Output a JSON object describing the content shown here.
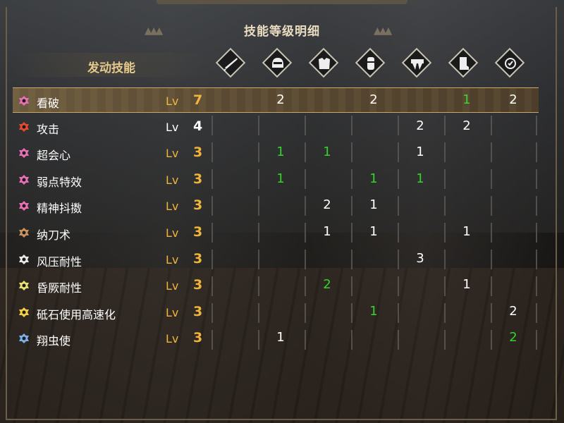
{
  "title": "技能等级明细",
  "header_label": "发动技能",
  "lv_label": "Lv",
  "slots": [
    {
      "icon": "weapon-icon"
    },
    {
      "icon": "helmet-icon"
    },
    {
      "icon": "chest-armor-icon"
    },
    {
      "icon": "arm-armor-icon"
    },
    {
      "icon": "waist-armor-icon"
    },
    {
      "icon": "leg-armor-icon"
    },
    {
      "icon": "talisman-icon"
    }
  ],
  "colors": {
    "level_gold": "#f0b43a",
    "decoration_green": "#33d32b",
    "highlight": "#6b5a3e"
  },
  "rows": [
    {
      "name": "看破",
      "icon_color": "#e86fb3",
      "level": "7",
      "lv_style": "gold",
      "highlight": true,
      "cells": [
        {
          "v": ""
        },
        {
          "v": "2",
          "c": "white"
        },
        {
          "v": ""
        },
        {
          "v": "2",
          "c": "white"
        },
        {
          "v": ""
        },
        {
          "v": "1",
          "c": "green"
        },
        {
          "v": "2",
          "c": "white"
        }
      ]
    },
    {
      "name": "攻击",
      "icon_color": "#e34a2f",
      "level": "4",
      "lv_style": "white",
      "highlight": false,
      "cells": [
        {
          "v": ""
        },
        {
          "v": ""
        },
        {
          "v": ""
        },
        {
          "v": ""
        },
        {
          "v": "2",
          "c": "white"
        },
        {
          "v": "2",
          "c": "white"
        },
        {
          "v": ""
        }
      ]
    },
    {
      "name": "超会心",
      "icon_color": "#e86fb3",
      "level": "3",
      "lv_style": "gold",
      "highlight": false,
      "cells": [
        {
          "v": ""
        },
        {
          "v": "1",
          "c": "green"
        },
        {
          "v": "1",
          "c": "green"
        },
        {
          "v": ""
        },
        {
          "v": "1",
          "c": "white"
        },
        {
          "v": ""
        },
        {
          "v": ""
        }
      ]
    },
    {
      "name": "弱点特效",
      "icon_color": "#e86fb3",
      "level": "3",
      "lv_style": "gold",
      "highlight": false,
      "cells": [
        {
          "v": ""
        },
        {
          "v": "1",
          "c": "green"
        },
        {
          "v": ""
        },
        {
          "v": "1",
          "c": "green"
        },
        {
          "v": "1",
          "c": "green"
        },
        {
          "v": ""
        },
        {
          "v": ""
        }
      ]
    },
    {
      "name": "精神抖擞",
      "icon_color": "#e86fb3",
      "level": "3",
      "lv_style": "gold",
      "highlight": false,
      "cells": [
        {
          "v": ""
        },
        {
          "v": ""
        },
        {
          "v": "2",
          "c": "white"
        },
        {
          "v": "1",
          "c": "white"
        },
        {
          "v": ""
        },
        {
          "v": ""
        },
        {
          "v": ""
        }
      ]
    },
    {
      "name": "纳刀术",
      "icon_color": "#c99060",
      "level": "3",
      "lv_style": "gold",
      "highlight": false,
      "cells": [
        {
          "v": ""
        },
        {
          "v": ""
        },
        {
          "v": "1",
          "c": "white"
        },
        {
          "v": "1",
          "c": "white"
        },
        {
          "v": ""
        },
        {
          "v": "1",
          "c": "white"
        },
        {
          "v": ""
        }
      ]
    },
    {
      "name": "风压耐性",
      "icon_color": "#e8e8e8",
      "level": "3",
      "lv_style": "gold",
      "highlight": false,
      "cells": [
        {
          "v": ""
        },
        {
          "v": ""
        },
        {
          "v": ""
        },
        {
          "v": ""
        },
        {
          "v": "3",
          "c": "white"
        },
        {
          "v": ""
        },
        {
          "v": ""
        }
      ]
    },
    {
      "name": "昏厥耐性",
      "icon_color": "#e8e070",
      "level": "3",
      "lv_style": "gold",
      "highlight": false,
      "cells": [
        {
          "v": ""
        },
        {
          "v": ""
        },
        {
          "v": "2",
          "c": "green"
        },
        {
          "v": ""
        },
        {
          "v": ""
        },
        {
          "v": "1",
          "c": "white"
        },
        {
          "v": ""
        }
      ]
    },
    {
      "name": "砥石使用高速化",
      "icon_color": "#f0d040",
      "level": "3",
      "lv_style": "gold",
      "highlight": false,
      "cells": [
        {
          "v": ""
        },
        {
          "v": ""
        },
        {
          "v": ""
        },
        {
          "v": "1",
          "c": "green"
        },
        {
          "v": ""
        },
        {
          "v": ""
        },
        {
          "v": "2",
          "c": "white"
        }
      ]
    },
    {
      "name": "翔虫使",
      "icon_color": "#7ab0e8",
      "level": "3",
      "lv_style": "gold",
      "highlight": false,
      "cells": [
        {
          "v": ""
        },
        {
          "v": "1",
          "c": "white"
        },
        {
          "v": ""
        },
        {
          "v": ""
        },
        {
          "v": ""
        },
        {
          "v": ""
        },
        {
          "v": "2",
          "c": "green"
        }
      ]
    }
  ]
}
